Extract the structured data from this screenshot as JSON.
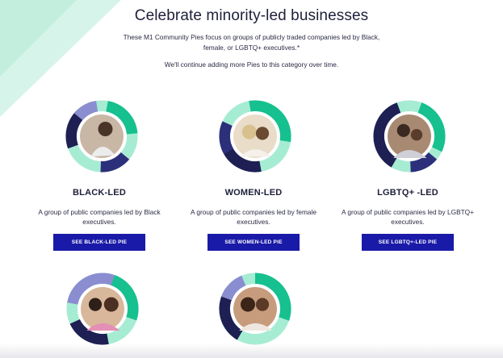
{
  "header": {
    "title": "Celebrate minority-led businesses",
    "intro": "These M1 Community Pies focus on groups of publicly traded companies led by Black, female, or LGBTQ+ executives.*",
    "note": "We'll continue adding more Pies to this category over time."
  },
  "cards": [
    {
      "name": "BLACK-LED",
      "description": "A group of public companies led by Black executives.",
      "button": "SEE BLACK-LED PIE"
    },
    {
      "name": "WOMEN-LED",
      "description": "A group of public companies led by female executives.",
      "button": "SEE WOMEN-LED PIE"
    },
    {
      "name": "LGBTQ+ -LED",
      "description": "A group of public companies led by LGBTQ+ executives.",
      "button": "SEE LGBTQ+-LED PIE"
    },
    {
      "name": "",
      "description": "",
      "button": ""
    },
    {
      "name": "",
      "description": "",
      "button": ""
    }
  ],
  "colors": {
    "navy": "#1e1f52",
    "indigo": "#2c2f7a",
    "lavender": "#8a8ed0",
    "green": "#16c08f",
    "mint": "#a6ecd3",
    "button": "#1a1aa8",
    "corner": "#d7f4ea"
  },
  "icons": [
    "pie-ring-icon",
    "photo-placeholder-icon"
  ]
}
